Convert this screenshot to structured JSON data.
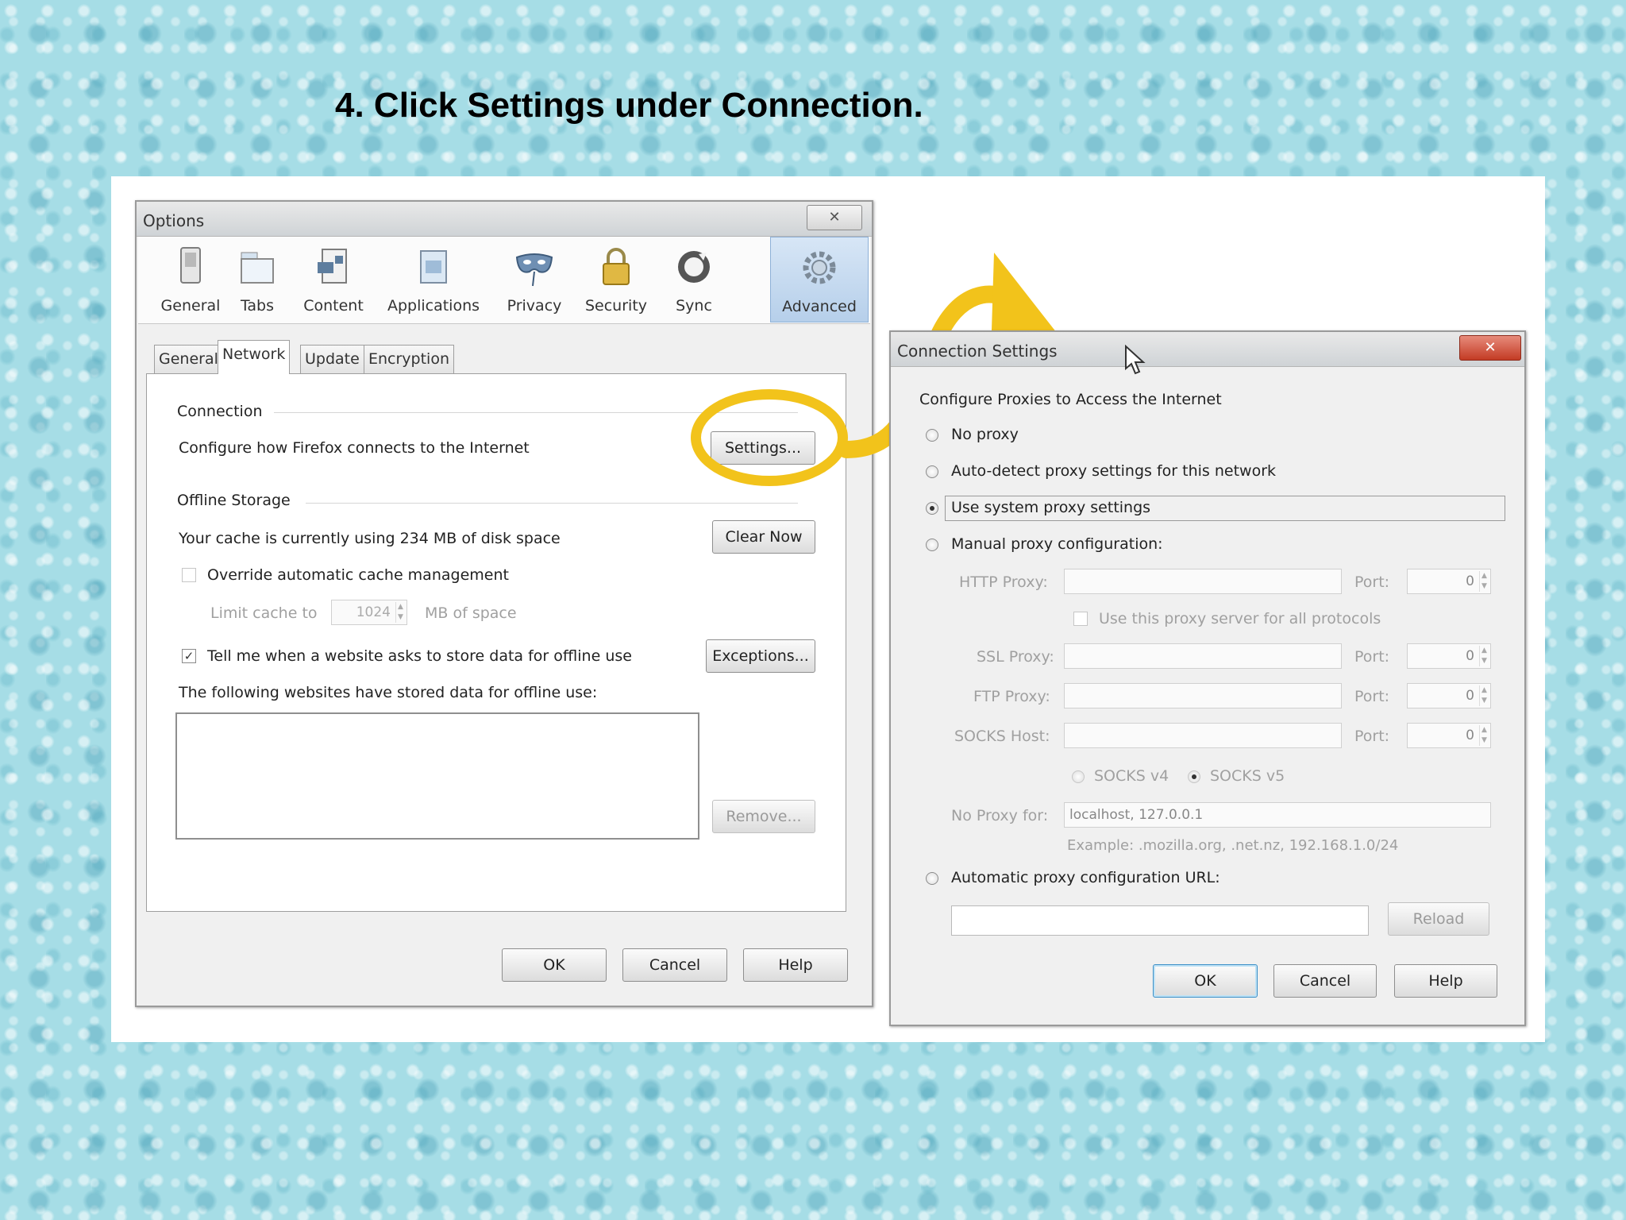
{
  "slide": {
    "title": "4. Click Settings under Connection."
  },
  "options_dialog": {
    "title": "Options",
    "close": "✕",
    "toolbar": [
      {
        "name": "general",
        "label": "General"
      },
      {
        "name": "tabs",
        "label": "Tabs"
      },
      {
        "name": "content",
        "label": "Content"
      },
      {
        "name": "applications",
        "label": "Applications"
      },
      {
        "name": "privacy",
        "label": "Privacy"
      },
      {
        "name": "security",
        "label": "Security"
      },
      {
        "name": "sync",
        "label": "Sync"
      },
      {
        "name": "advanced",
        "label": "Advanced"
      }
    ],
    "tabs": [
      "General",
      "Network",
      "Update",
      "Encryption"
    ],
    "connection": {
      "heading": "Connection",
      "description": "Configure how Firefox connects to the Internet",
      "settings_button": "Settings..."
    },
    "offline": {
      "heading": "Offline Storage",
      "cache_text": "Your cache is currently using 234 MB of disk space",
      "clear_button": "Clear Now",
      "override_label": "Override automatic cache management",
      "limit_label": "Limit cache to",
      "limit_value": "1024",
      "limit_units": "MB of space",
      "tell_label": "Tell me when a website asks to store data for offline use",
      "exceptions_button": "Exceptions...",
      "stored_label": "The following websites have stored data for offline use:",
      "remove_button": "Remove..."
    },
    "buttons": {
      "ok": "OK",
      "cancel": "Cancel",
      "help": "Help"
    }
  },
  "connection_dialog": {
    "title": "Connection Settings",
    "close": "✕",
    "heading": "Configure Proxies to Access the Internet",
    "options": {
      "no_proxy": "No proxy",
      "auto_detect": "Auto-detect proxy settings for this network",
      "system": "Use system proxy settings",
      "manual": "Manual proxy configuration:",
      "auto_url": "Automatic proxy configuration URL:"
    },
    "http_label": "HTTP Proxy:",
    "port_label": "Port:",
    "port_value": "0",
    "same_proxy_label": "Use this proxy server for all protocols",
    "ssl_label": "SSL Proxy:",
    "ftp_label": "FTP Proxy:",
    "socks_label": "SOCKS Host:",
    "socks_v4": "SOCKS v4",
    "socks_v5": "SOCKS v5",
    "no_proxy_for_label": "No Proxy for:",
    "no_proxy_for_value": "localhost, 127.0.0.1",
    "example": "Example: .mozilla.org, .net.nz, 192.168.1.0/24",
    "reload_button": "Reload",
    "buttons": {
      "ok": "OK",
      "cancel": "Cancel",
      "help": "Help"
    }
  },
  "colors": {
    "highlight": "#f2c31b",
    "active_toolbar": "#b6cfea",
    "close_red": "#c33b24"
  }
}
